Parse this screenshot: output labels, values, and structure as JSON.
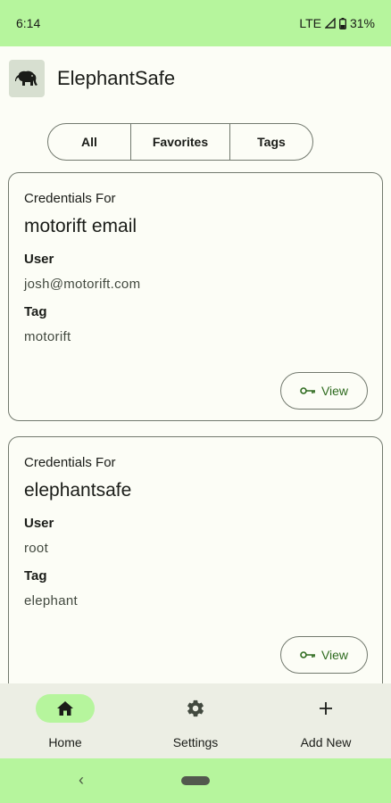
{
  "status": {
    "time": "6:14",
    "network": "LTE",
    "battery": "31%"
  },
  "app": {
    "title": "ElephantSafe",
    "logo_icon": "elephant-icon"
  },
  "filter": {
    "all": "All",
    "favorites": "Favorites",
    "tags": "Tags"
  },
  "cards": [
    {
      "heading": "Credentials For",
      "name": "motorift email",
      "user_label": "User",
      "user": "josh@motorift.com",
      "tag_label": "Tag",
      "tag": "motorift",
      "view_label": "View"
    },
    {
      "heading": "Credentials For",
      "name": "elephantsafe",
      "user_label": "User",
      "user": "root",
      "tag_label": "Tag",
      "tag": "elephant",
      "view_label": "View"
    }
  ],
  "nav": {
    "home": "Home",
    "settings": "Settings",
    "add_new": "Add New"
  },
  "colors": {
    "accent": "#b6f59d",
    "view_text": "#2e6b1f",
    "background": "#fcfdf6",
    "outline": "#72796e"
  }
}
